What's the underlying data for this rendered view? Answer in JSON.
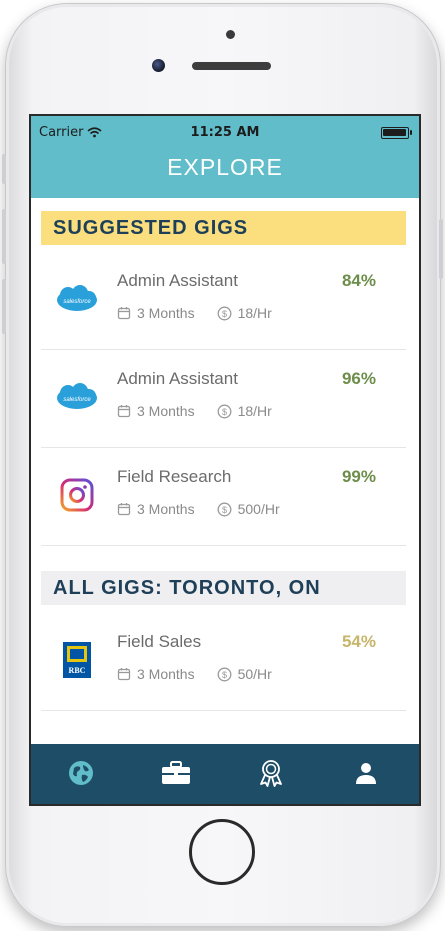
{
  "status_bar": {
    "carrier": "Carrier",
    "time": "11:25 AM",
    "battery_level": 0.95
  },
  "header": {
    "title": "EXPLORE"
  },
  "sections": {
    "suggested": {
      "label": "SUGGESTED GIGS"
    },
    "all": {
      "label": "ALL GIGS: TORONTO, ON"
    }
  },
  "gigs": [
    {
      "title": "Admin Assistant",
      "match": "84%",
      "duration": "3 Months",
      "rate": "18/Hr",
      "company_icon": "salesforce-logo",
      "match_color": "#6d8e4a"
    },
    {
      "title": "Admin Assistant",
      "match": "96%",
      "duration": "3 Months",
      "rate": "18/Hr",
      "company_icon": "salesforce-logo",
      "match_color": "#6d8e4a"
    },
    {
      "title": "Field Research",
      "match": "99%",
      "duration": "3 Months",
      "rate": "500/Hr",
      "company_icon": "instagram-logo",
      "match_color": "#6d8e4a"
    },
    {
      "title": "Field Sales",
      "match": "54%",
      "duration": "3 Months",
      "rate": "50/Hr",
      "company_icon": "rbc-logo",
      "match_color": "#c7b56a"
    }
  ],
  "logos": {
    "salesforce": "salesforce",
    "rbc": "RBC"
  },
  "tabs": [
    {
      "name": "explore",
      "icon": "globe-icon",
      "active": true
    },
    {
      "name": "gigs",
      "icon": "briefcase-icon",
      "active": false
    },
    {
      "name": "achievements",
      "icon": "ribbon-award-icon",
      "active": false
    },
    {
      "name": "profile",
      "icon": "person-icon",
      "active": false
    }
  ],
  "colors": {
    "header": "#60bdc9",
    "tabbar": "#1e4d67",
    "suggested_bar": "#fbde7e",
    "all_bar": "#efeef0",
    "active_tab": "#60bdc9"
  }
}
